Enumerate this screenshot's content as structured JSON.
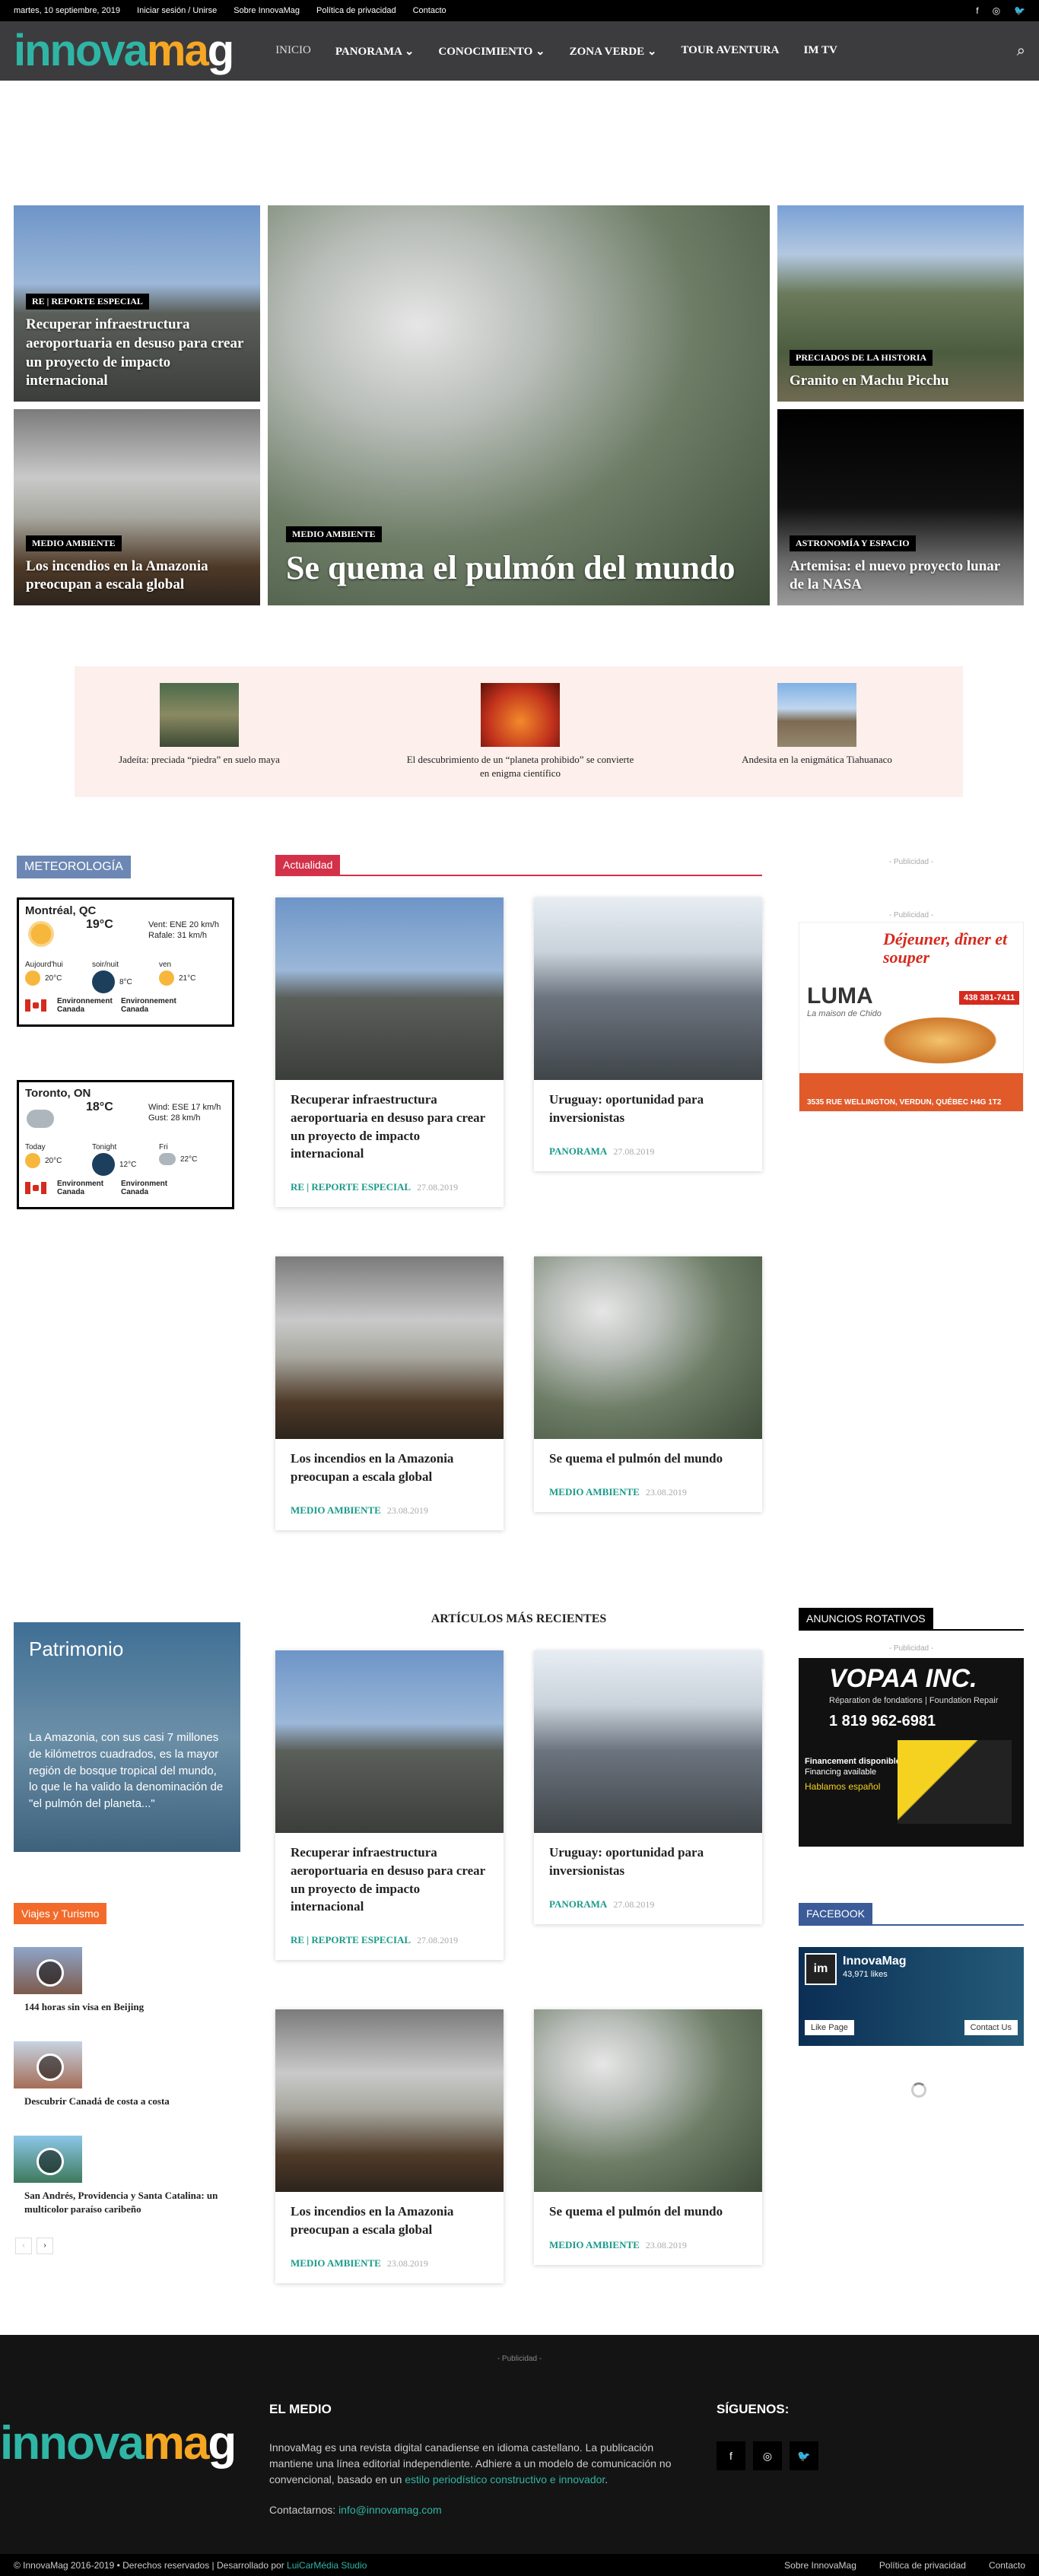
{
  "topbar": {
    "date": "martes, 10 septiembre, 2019",
    "login": "Iniciar sesión / Unirse",
    "about": "Sobre InnovaMag",
    "privacy": "Política de privacidad",
    "contact": "Contacto"
  },
  "logo": {
    "part1": "innova",
    "part2": "ma",
    "part3": "g"
  },
  "menu": {
    "inicio": "INICIO",
    "panorama": "PANORAMA",
    "conocimiento": "CONOCIMIENTO",
    "zona_verde": "ZONA VERDE",
    "tour": "TOUR AVENTURA",
    "imtv": "IM TV"
  },
  "hero": {
    "t1": {
      "cat": "RE | REPORTE ESPECIAL",
      "title": "Recuperar infraestructura aeroportuaria en desuso para crear un proyecto de impacto internacional"
    },
    "t2": {
      "cat": "MEDIO AMBIENTE",
      "title": "Los incendios en la Amazonia preocupan a escala global"
    },
    "t3": {
      "cat": "MEDIO AMBIENTE",
      "title": "Se quema el pulmón del mundo"
    },
    "t4": {
      "cat": "PRECIADOS DE LA HISTORIA",
      "title": "Granito en Machu Picchu"
    },
    "t5": {
      "cat": "ASTRONOMÍA Y ESPACIO",
      "title": "Artemisa: el nuevo proyecto lunar de la NASA"
    }
  },
  "strip": {
    "a": "Jadeíta: preciada “piedra” en suelo maya",
    "b": "El descubrimiento de un “planeta prohibido” se convierte en enigma científico",
    "c": "Andesita en la enigmática Tiahuanaco"
  },
  "weather": {
    "label": "METEOROLOGÍA",
    "w1": {
      "city": "Montréal, QC",
      "temp": "19°C",
      "wind": "Vent: ENE 20 km/h",
      "gust": "Rafale: 31 km/h",
      "d1": "Aujourd'hui",
      "t1": "20°C",
      "d2": "soir/nuit",
      "t2": "8°C",
      "d3": "ven",
      "t3": "21°C",
      "src": "Environnement Canada"
    },
    "w2": {
      "city": "Toronto, ON",
      "temp": "18°C",
      "wind": "Wind: ESE 17 km/h",
      "gust": "Gust: 28 km/h",
      "d1": "Today",
      "t1": "20°C",
      "d2": "Tonight",
      "t2": "12°C",
      "d3": "Fri",
      "t3": "22°C",
      "src": "Environment Canada"
    }
  },
  "actualidad": {
    "label": "Actualidad"
  },
  "cards": {
    "c1": {
      "title": "Recuperar infraestructura aeroportuaria en desuso para crear un proyecto de impacto internacional",
      "cat": "RE | REPORTE ESPECIAL",
      "date": "27.08.2019"
    },
    "c2": {
      "title": "Uruguay: oportunidad para inversionistas",
      "cat": "PANORAMA",
      "date": "27.08.2019"
    },
    "c3": {
      "title": "Los incendios en la Amazonia preocupan a escala global",
      "cat": "MEDIO AMBIENTE",
      "date": "23.08.2019"
    },
    "c4": {
      "title": "Se quema el pulmón del mundo",
      "cat": "MEDIO AMBIENTE",
      "date": "23.08.2019"
    }
  },
  "ads": {
    "pub": "- Publicidad -",
    "luma_title": "Déjeuner, dîner et souper",
    "luma_name": "LUMA",
    "luma_sub": "La maison de Chido",
    "luma_phone": "438 381-7411",
    "luma_addr": "3535 RUE WELLINGTON, VERDUN, QUÉBEC H4G 1T2",
    "rot_label": "ANUNCIOS ROTATIVOS",
    "vopaa": "VOPAA INC.",
    "vopaa_sub": "Réparation de fondations | Foundation Repair",
    "vopaa_phone": "1 819 962-6981",
    "vopaa_fin": "Financement disponible",
    "vopaa_fin2": "Financing available",
    "vopaa_es": "Hablamos español"
  },
  "recent": {
    "label": "ARTÍCULOS MÁS RECIENTES"
  },
  "patrimonio": {
    "title": "Patrimonio",
    "text": "La Amazonia, con sus casi 7 millones de kilómetros cuadrados, es la mayor región de bosque tropical del mundo, lo que le ha valido la denominación de \"el pulmón del planeta...\""
  },
  "viajes": {
    "label": "Viajes y Turismo",
    "v1": "144 horas sin visa en Beijing",
    "v2": "Descubrir Canadá de costa a costa",
    "v3": "San Andrés, Providencia y Santa Catalina: un multicolor paraíso caribeño"
  },
  "facebook": {
    "label": "FACEBOOK",
    "name": "InnovaMag",
    "likes": "43,971 likes",
    "like": "Like Page",
    "contact": "Contact Us"
  },
  "footer": {
    "pub": "- Publicidad -",
    "medio": "EL MEDIO",
    "desc": "InnovaMag es una revista digital canadiense en idioma castellano. La publicación mantiene una línea editorial independiente. Adhiere a un modelo de comunicación no convencional, basado en un",
    "link": "estilo periodístico constructivo e innovador",
    "contact_label": "Contactarnos:",
    "email": "info@innovamag.com",
    "siguenos": "SÍGUENOS:",
    "copy": "© InnovaMag 2016-2019 • Derechos reservados | Desarrollado por",
    "dev": "LuiCarMédia Studio",
    "about": "Sobre InnovaMag",
    "privacy": "Política de privacidad",
    "contact": "Contacto"
  }
}
